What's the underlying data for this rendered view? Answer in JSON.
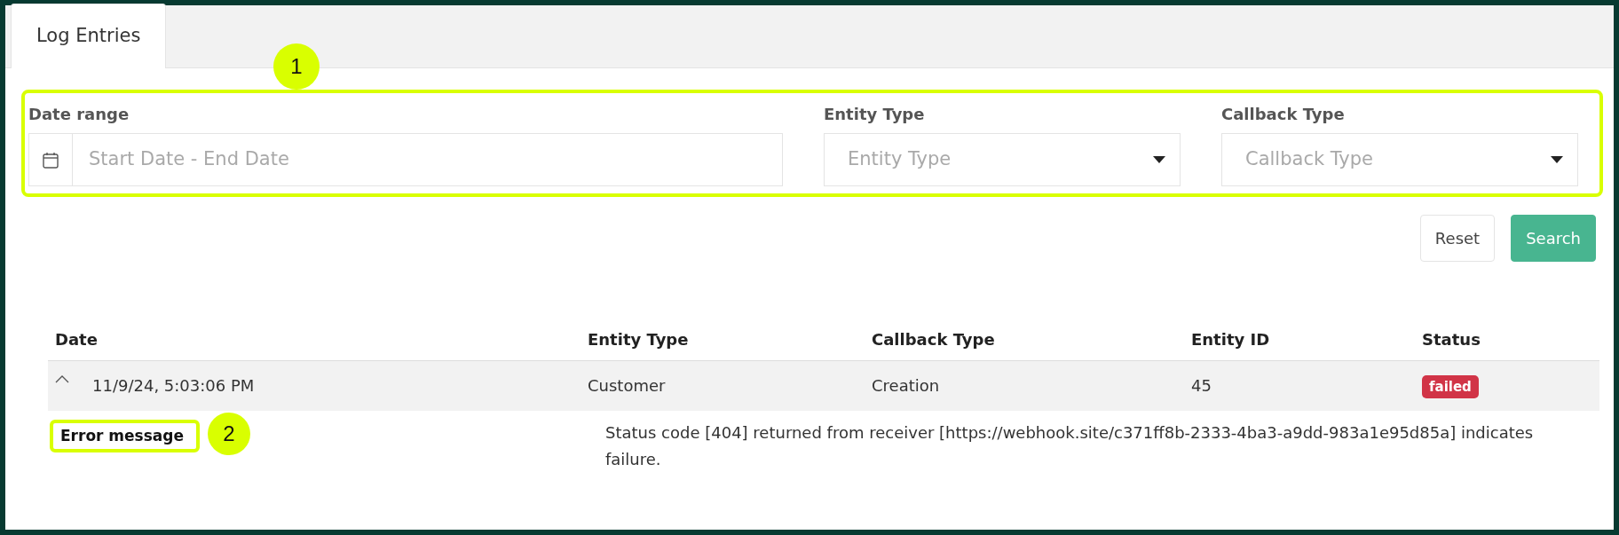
{
  "tabs": [
    {
      "label": "Log Entries",
      "selected": true
    }
  ],
  "filters": {
    "callout": "1",
    "fields": [
      {
        "kind": "daterange",
        "label": "Date range",
        "placeholder": "Start Date - End Date"
      },
      {
        "kind": "select",
        "label": "Entity Type",
        "placeholder": "Entity Type"
      },
      {
        "kind": "select",
        "label": "Callback Type",
        "placeholder": "Callback Type"
      }
    ]
  },
  "buttons": [
    {
      "label": "Reset",
      "kind": "secondary"
    },
    {
      "label": "Search",
      "kind": "primary"
    }
  ],
  "table": {
    "columns": [
      "Date",
      "Entity Type",
      "Callback Type",
      "Entity ID",
      "Status"
    ],
    "rows": [
      {
        "expanded": true,
        "date": "11/9/24, 5:03:06 PM",
        "entity_type": "Customer",
        "callback_type": "Creation",
        "entity_id": "45",
        "status": "failed",
        "color": "#d13447",
        "detail": {
          "label": "Error message",
          "callout": "2",
          "message": "Status code [404] returned from receiver [https://webhook.site/c371ff8b-2333-4ba3-a9dd-983a1e95d85a] indicates failure."
        }
      }
    ]
  }
}
